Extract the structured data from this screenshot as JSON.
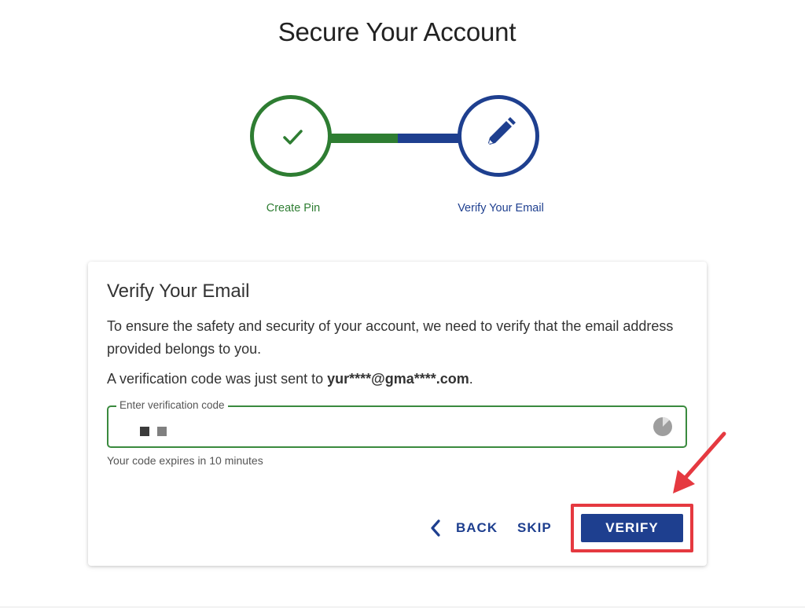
{
  "page": {
    "title": "Secure Your Account"
  },
  "stepper": {
    "steps": [
      {
        "label": "Create Pin",
        "state": "completed",
        "icon": "checkmark-icon",
        "color": "#2e7d32"
      },
      {
        "label": "Verify Your Email",
        "state": "active",
        "icon": "pencil-icon",
        "color": "#1e3f8f"
      }
    ]
  },
  "card": {
    "title": "Verify Your Email",
    "description": "To ensure the safety and security of your account, we need to verify that the email address provided belongs to you.",
    "sent_prefix": "A verification code was just sent to ",
    "email_masked": "yur****@gma****.com",
    "sent_suffix": ".",
    "code_field": {
      "label": "Enter verification code",
      "icon": "timer-icon"
    },
    "hint": "Your code expires in 10 minutes",
    "actions": {
      "back_label": "BACK",
      "skip_label": "SKIP",
      "verify_label": "VERIFY"
    }
  },
  "annotation": {
    "highlight_color": "#e53940",
    "arrow": "annotation-arrow-icon"
  }
}
